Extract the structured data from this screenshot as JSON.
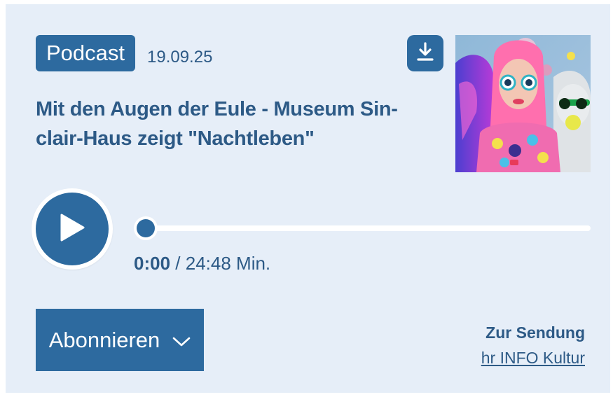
{
  "episode": {
    "badge": "Podcast",
    "date": "19.09.25",
    "title": "Mit den Augen der Eule - Museum Sin-clair-Haus zeigt \"Nachtleben\""
  },
  "player": {
    "current_time": "0:00",
    "separator": "/",
    "duration": "24:48 Min.",
    "progress": 0
  },
  "actions": {
    "subscribe_label": "Abonnieren",
    "show_label": "Zur Sendung",
    "show_link": "hr INFO Kultur"
  },
  "icons": {
    "download": "download-icon",
    "play": "play-icon",
    "chevron": "chevron-down-icon"
  },
  "colors": {
    "accent": "#2d6a9f",
    "background": "#e6eef8",
    "text": "#2d5a86"
  }
}
